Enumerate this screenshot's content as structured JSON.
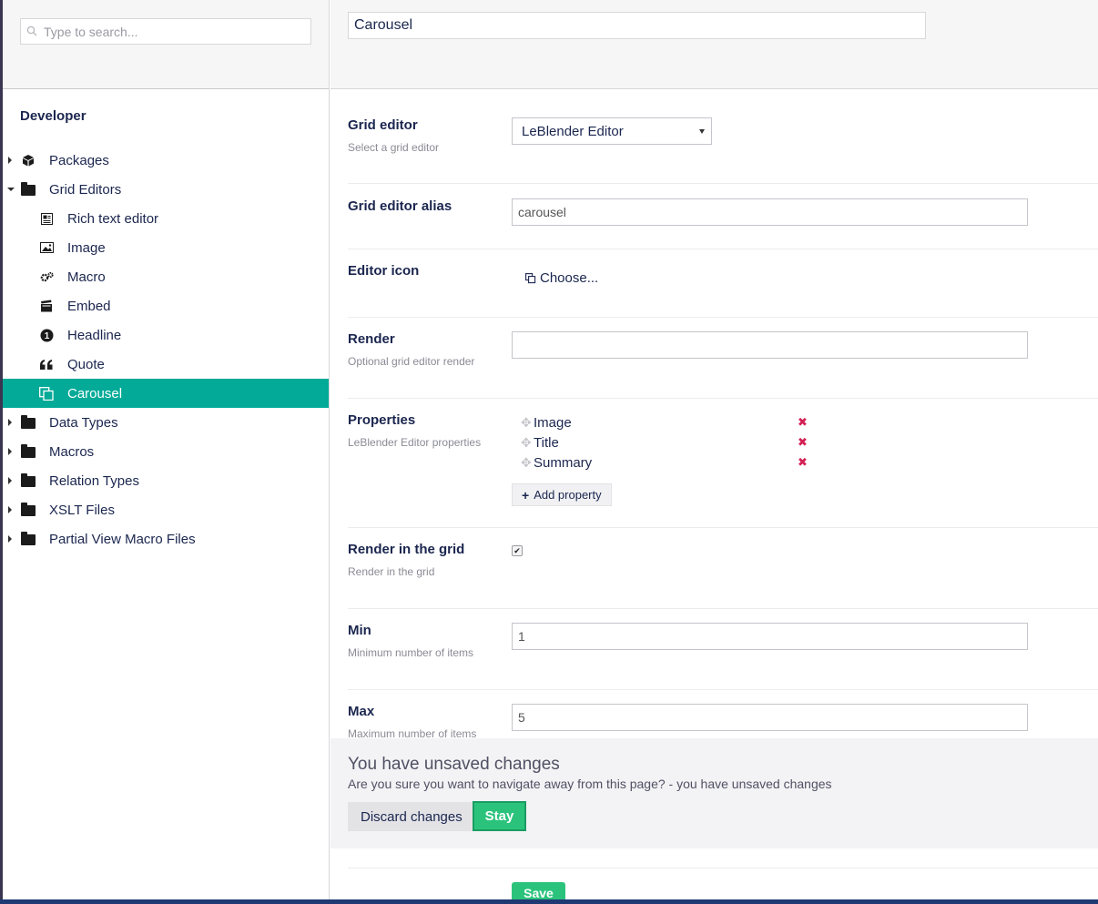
{
  "search": {
    "placeholder": "Type to search..."
  },
  "sidebar": {
    "section_title": "Developer",
    "items": [
      {
        "label": "Packages",
        "icon": "package-icon"
      },
      {
        "label": "Grid Editors",
        "icon": "folder-icon"
      },
      {
        "label": "Rich text editor",
        "icon": "document-icon"
      },
      {
        "label": "Image",
        "icon": "image-icon"
      },
      {
        "label": "Macro",
        "icon": "settings-icon"
      },
      {
        "label": "Embed",
        "icon": "clapperboard-icon"
      },
      {
        "label": "Headline",
        "icon": "number-one-icon"
      },
      {
        "label": "Quote",
        "icon": "quote-icon"
      },
      {
        "label": "Carousel",
        "icon": "carousel-icon"
      },
      {
        "label": "Data Types",
        "icon": "folder-icon"
      },
      {
        "label": "Macros",
        "icon": "folder-icon"
      },
      {
        "label": "Relation Types",
        "icon": "folder-icon"
      },
      {
        "label": "XSLT Files",
        "icon": "folder-icon"
      },
      {
        "label": "Partial View Macro Files",
        "icon": "folder-icon"
      }
    ],
    "active_color": "#03aa97"
  },
  "header": {
    "name_value": "Carousel"
  },
  "props": {
    "grid_editor": {
      "label": "Grid editor",
      "desc": "Select a grid editor",
      "value": "LeBlender Editor"
    },
    "alias": {
      "label": "Grid editor alias",
      "value": "carousel"
    },
    "icon": {
      "label": "Editor icon",
      "choose": "Choose..."
    },
    "render": {
      "label": "Render",
      "desc": "Optional grid editor render",
      "value": ""
    },
    "properties": {
      "label": "Properties",
      "desc": "LeBlender Editor properties",
      "items": [
        "Image",
        "Title",
        "Summary"
      ],
      "add_label": "Add property"
    },
    "render_grid": {
      "label": "Render in the grid",
      "desc": "Render in the grid",
      "checked": true
    },
    "min": {
      "label": "Min",
      "desc": "Minimum number of items",
      "value": "1"
    },
    "max": {
      "label": "Max",
      "desc": "Maximum number of items",
      "value": "5"
    }
  },
  "overlay": {
    "title": "You have unsaved changes",
    "message": "Are you sure you want to navigate away from this page? - you have unsaved changes",
    "discard_label": "Discard changes",
    "stay_label": "Stay"
  },
  "save_label": "Save"
}
